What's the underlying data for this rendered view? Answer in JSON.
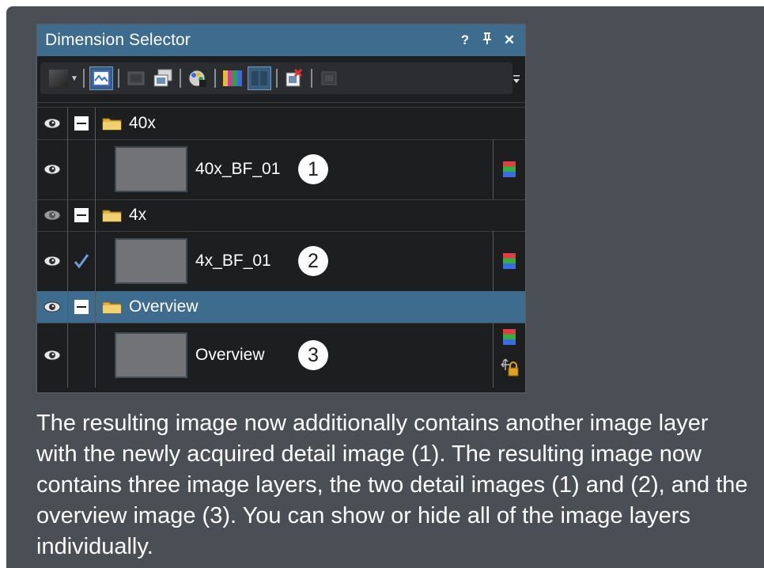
{
  "panel": {
    "title": "Dimension Selector",
    "title_buttons": [
      "?",
      "†",
      "✕"
    ]
  },
  "toolbar": {
    "tools": [
      "layer-mode-icon",
      "image-view-icon",
      "disabled-tool-icon",
      "image-copy-icon",
      "palette-icon",
      "channels-icon",
      "split-view-icon",
      "delete-layer-icon",
      "disabled-square-icon"
    ],
    "overflow_glyph": "≡"
  },
  "layers": [
    {
      "type": "folder",
      "label": "40x",
      "expanded": true
    },
    {
      "type": "image",
      "label": "40x_BF_01",
      "callout": "1",
      "checked": false
    },
    {
      "type": "folder",
      "label": "4x",
      "expanded": true
    },
    {
      "type": "image",
      "label": "4x_BF_01",
      "callout": "2",
      "checked": true
    },
    {
      "type": "folder",
      "label": "Overview",
      "expanded": true,
      "selected": true
    },
    {
      "type": "image",
      "label": "Overview",
      "callout": "3",
      "checked": false,
      "locked": true
    }
  ],
  "caption": {
    "p1": "The resulting image now additionally contains another image layer with the newly acquired detail image ",
    "r1": "(1)",
    "p2": ". The resulting image now contains three image layers, the two detail images ",
    "r2": "(1)",
    "p3": " and ",
    "r3": "(2)",
    "p4": ", and the overview image ",
    "r4": "(3)",
    "p5": ". You can show or hide all of the image layers individually."
  },
  "colors": {
    "background": "#4a4f55",
    "panel": "#1d1e20",
    "accent": "#3d6c8f"
  }
}
